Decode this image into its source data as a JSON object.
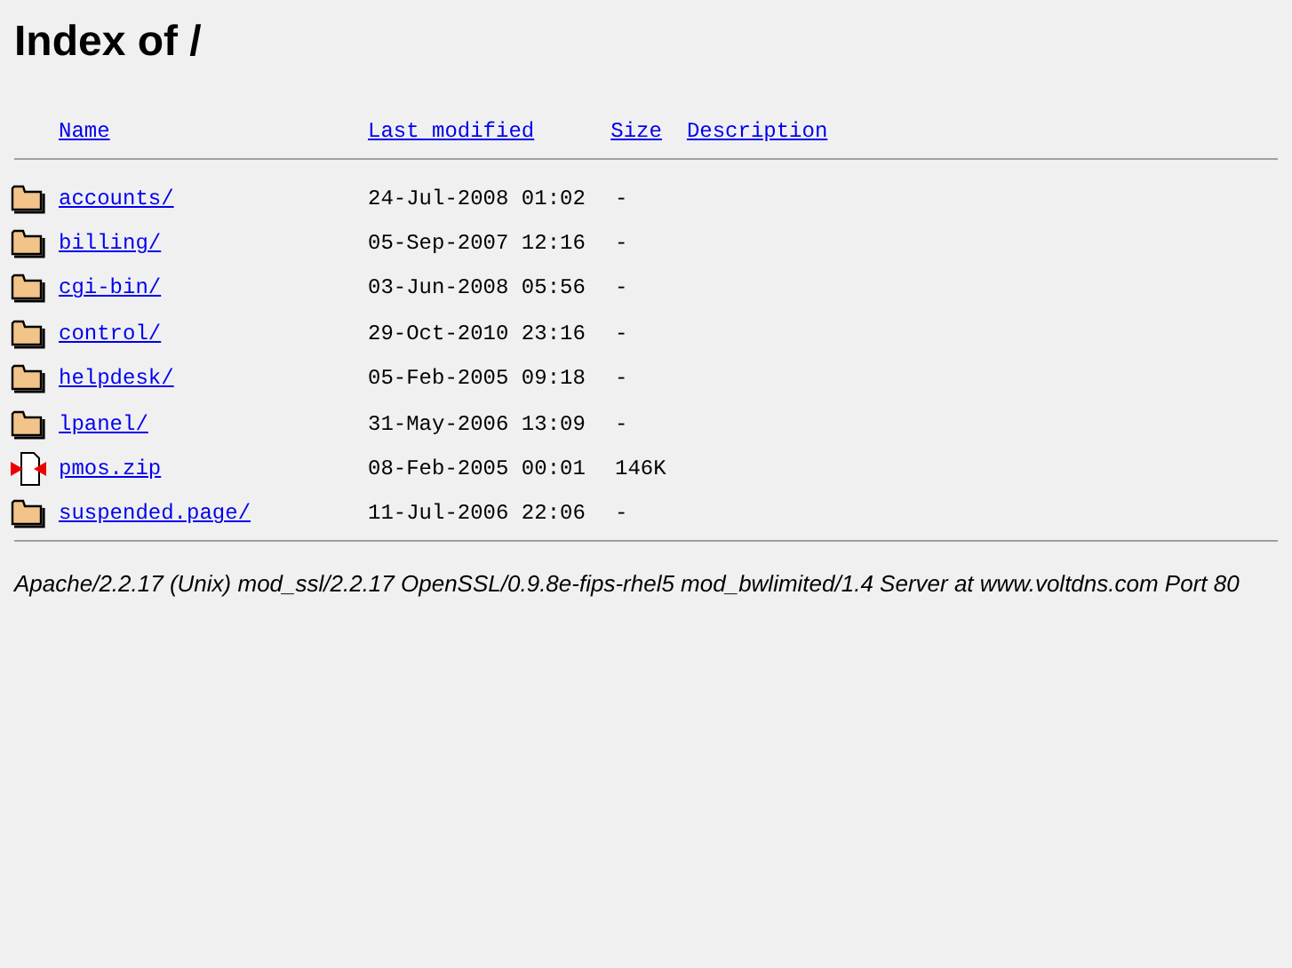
{
  "title": "Index of /",
  "columns": [
    "Name",
    "Last modified",
    "Size",
    "Description"
  ],
  "rows": [
    {
      "kind": "folder",
      "name": "accounts/",
      "modified": "24-Jul-2008 01:02",
      "size": "-"
    },
    {
      "kind": "folder",
      "name": "billing/",
      "modified": "05-Sep-2007 12:16",
      "size": "-"
    },
    {
      "kind": "folder",
      "name": "cgi-bin/",
      "modified": "03-Jun-2008 05:56",
      "size": "-"
    },
    {
      "kind": "folder",
      "name": "control/",
      "modified": "29-Oct-2010 23:16",
      "size": "-"
    },
    {
      "kind": "folder",
      "name": "helpdesk/",
      "modified": "05-Feb-2005 09:18",
      "size": "-"
    },
    {
      "kind": "folder",
      "name": "lpanel/",
      "modified": "31-May-2006 13:09",
      "size": "-"
    },
    {
      "kind": "file",
      "name": "pmos.zip",
      "modified": "08-Feb-2005 00:01",
      "size": "146K"
    },
    {
      "kind": "folder",
      "name": "suspended.page/",
      "modified": "11-Jul-2006 22:06",
      "size": "-"
    }
  ],
  "footer": "Apache/2.2.17 (Unix) mod_ssl/2.2.17 OpenSSL/0.9.8e-fips-rhel5 mod_bwlimited/1.4 Server at www.voltdns.com Port 80"
}
